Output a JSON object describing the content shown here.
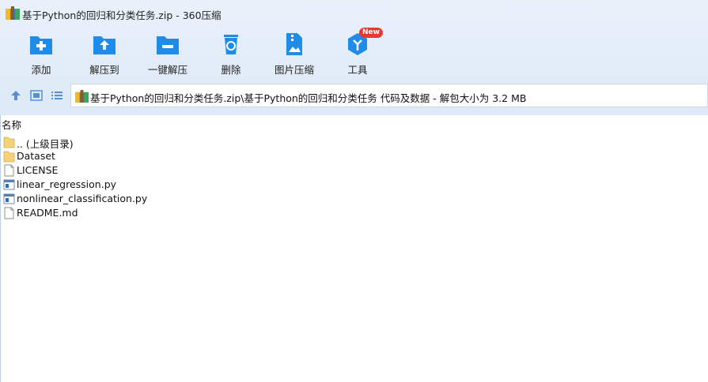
{
  "window": {
    "title": "基于Python的回归和分类任务.zip - 360压缩"
  },
  "toolbar": {
    "items": [
      {
        "label": "添加",
        "icon": "add-icon"
      },
      {
        "label": "解压到",
        "icon": "extract-to-icon"
      },
      {
        "label": "一键解压",
        "icon": "one-click-extract-icon"
      },
      {
        "label": "删除",
        "icon": "delete-icon"
      },
      {
        "label": "图片压缩",
        "icon": "image-compress-icon"
      },
      {
        "label": "工具",
        "icon": "tools-icon",
        "badge": "New"
      }
    ]
  },
  "address": {
    "path": "基于Python的回归和分类任务.zip\\基于Python的回归和分类任务 代码及数据 - 解包大小为 3.2 MB"
  },
  "list": {
    "column_name": "名称",
    "rows": [
      {
        "name": ".. (上级目录)",
        "type": "folder"
      },
      {
        "name": "Dataset",
        "type": "folder"
      },
      {
        "name": "LICENSE",
        "type": "file"
      },
      {
        "name": "linear_regression.py",
        "type": "python"
      },
      {
        "name": "nonlinear_classification.py",
        "type": "python"
      },
      {
        "name": "README.md",
        "type": "file"
      }
    ]
  },
  "colors": {
    "accent": "#1e8ce8",
    "header_bg": "#e3edf9",
    "badge": "#e8382f"
  }
}
